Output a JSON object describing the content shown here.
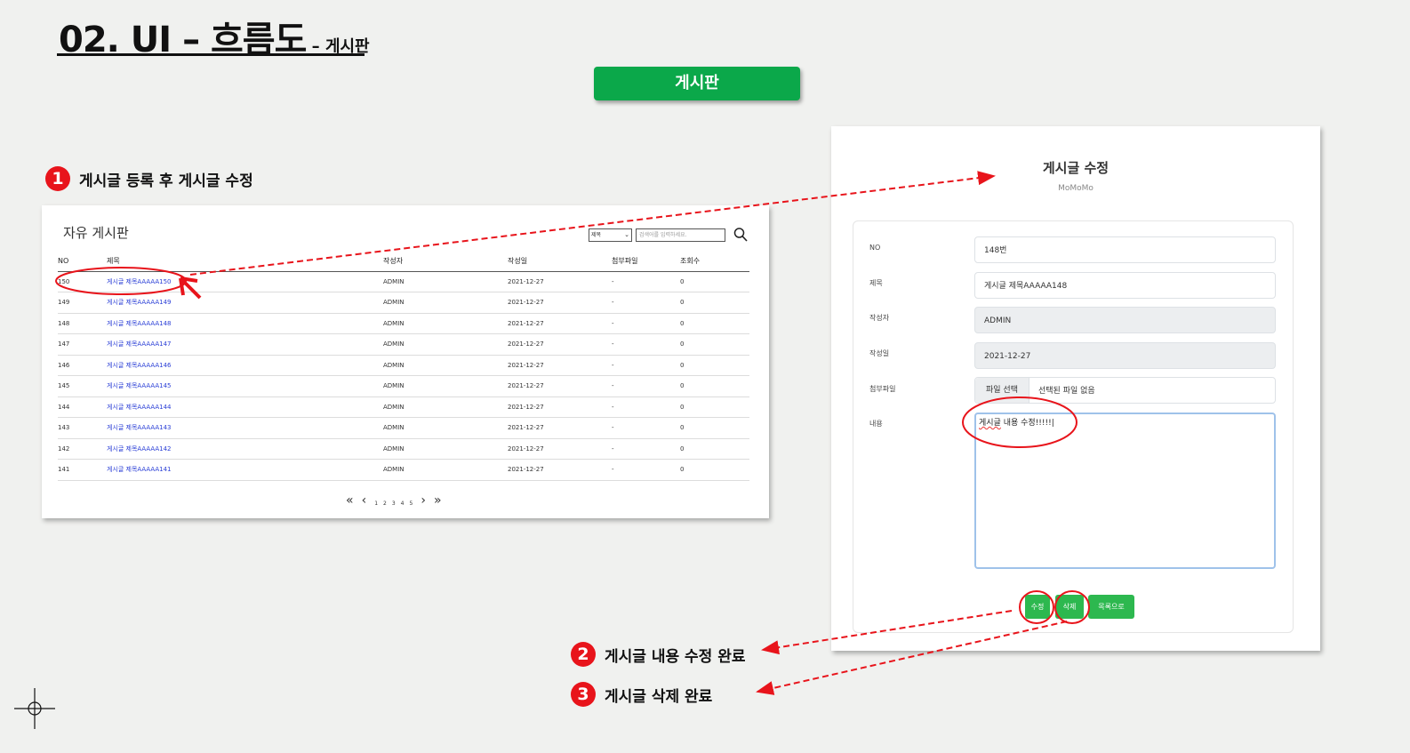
{
  "slide": {
    "title_main": "02. UI – 흐름도",
    "title_sub": " – 게시판",
    "section_tag": "게시판"
  },
  "steps": [
    {
      "num": "1",
      "label": "게시글 등록 후 게시글 수정"
    },
    {
      "num": "2",
      "label": "게시글 내용 수정 완료"
    },
    {
      "num": "3",
      "label": "게시글 삭제  완료"
    }
  ],
  "board": {
    "title": "자유 게시판",
    "search": {
      "select_value": "제목",
      "placeholder": "검색어를 입력하세요."
    },
    "columns": [
      "NO",
      "제목",
      "작성자",
      "작성일",
      "첨부파일",
      "조회수"
    ],
    "rows": [
      {
        "no": "150",
        "title": "게시글 제목AAAAA150",
        "writer": "ADMIN",
        "date": "2021-12-27",
        "file": "-",
        "views": "0"
      },
      {
        "no": "149",
        "title": "게시글 제목AAAAA149",
        "writer": "ADMIN",
        "date": "2021-12-27",
        "file": "-",
        "views": "0"
      },
      {
        "no": "148",
        "title": "게시글 제목AAAAA148",
        "writer": "ADMIN",
        "date": "2021-12-27",
        "file": "-",
        "views": "0"
      },
      {
        "no": "147",
        "title": "게시글 제목AAAAA147",
        "writer": "ADMIN",
        "date": "2021-12-27",
        "file": "-",
        "views": "0"
      },
      {
        "no": "146",
        "title": "게시글 제목AAAAA146",
        "writer": "ADMIN",
        "date": "2021-12-27",
        "file": "-",
        "views": "0"
      },
      {
        "no": "145",
        "title": "게시글 제목AAAAA145",
        "writer": "ADMIN",
        "date": "2021-12-27",
        "file": "-",
        "views": "0"
      },
      {
        "no": "144",
        "title": "게시글 제목AAAAA144",
        "writer": "ADMIN",
        "date": "2021-12-27",
        "file": "-",
        "views": "0"
      },
      {
        "no": "143",
        "title": "게시글 제목AAAAA143",
        "writer": "ADMIN",
        "date": "2021-12-27",
        "file": "-",
        "views": "0"
      },
      {
        "no": "142",
        "title": "게시글 제목AAAAA142",
        "writer": "ADMIN",
        "date": "2021-12-27",
        "file": "-",
        "views": "0"
      },
      {
        "no": "141",
        "title": "게시글 제목AAAAA141",
        "writer": "ADMIN",
        "date": "2021-12-27",
        "file": "-",
        "views": "0"
      }
    ],
    "pager": {
      "first": "«",
      "prev": "‹",
      "pages": [
        "1",
        "2",
        "3",
        "4",
        "5"
      ],
      "next": "›",
      "last": "»"
    }
  },
  "edit": {
    "title": "게시글 수정",
    "subtitle": "MoMoMo",
    "fields": {
      "no_label": "NO",
      "no_value": "148번",
      "title_label": "제목",
      "title_value": "게시글 제목AAAAA148",
      "writer_label": "작성자",
      "writer_value": "ADMIN",
      "date_label": "작성일",
      "date_value": "2021-12-27",
      "file_label": "첨부파일",
      "file_button": "파일 선택",
      "file_status": "선택된 파일 없음",
      "content_label": "내용",
      "content_value_a": "게시글",
      "content_value_b": " 내용 수정!!!!!"
    },
    "buttons": {
      "edit": "수정",
      "delete": "삭제",
      "list": "목록으로"
    }
  },
  "colors": {
    "accent_green": "#0ba84a",
    "button_green": "#2db84f",
    "annotation_red": "#e8141b",
    "link_blue": "#2a3ed6"
  }
}
